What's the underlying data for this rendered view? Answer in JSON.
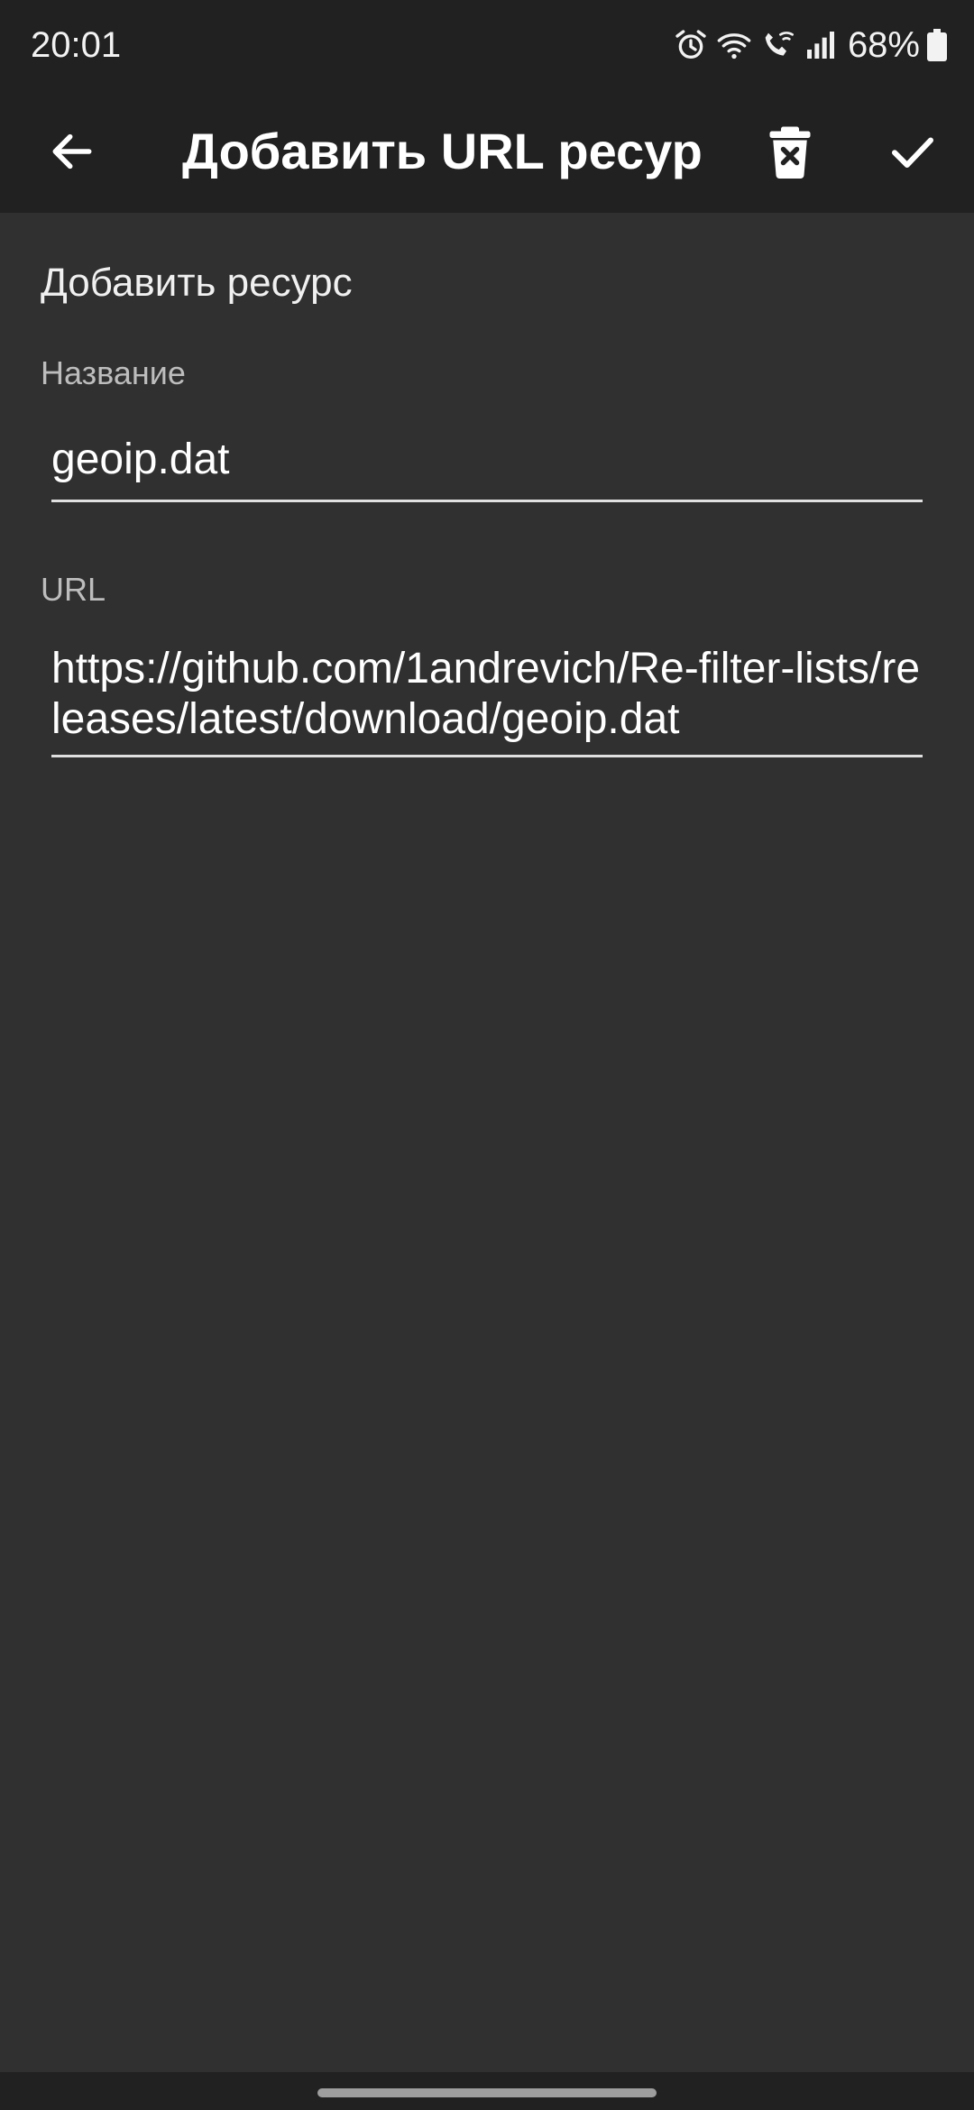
{
  "status_bar": {
    "time": "20:01",
    "battery": "68%",
    "icons": [
      "alarm-icon",
      "wifi-icon",
      "wifi-calling-icon",
      "signal-icon",
      "battery-icon"
    ]
  },
  "app_bar": {
    "title": "Добавить URL ресур...",
    "icons": [
      "back-arrow-icon",
      "delete-icon",
      "check-icon"
    ]
  },
  "form": {
    "section_title": "Добавить ресурс",
    "name": {
      "label": "Название",
      "value": "geoip.dat"
    },
    "url": {
      "label": "URL",
      "value": "https://github.com/1andrevich/Re-filter-lists/releases/latest/download/geoip.dat"
    }
  },
  "colors": {
    "background": "#303030",
    "app_bar": "#212121",
    "text_primary": "#ffffff",
    "text_secondary": "#bdbdbd"
  }
}
